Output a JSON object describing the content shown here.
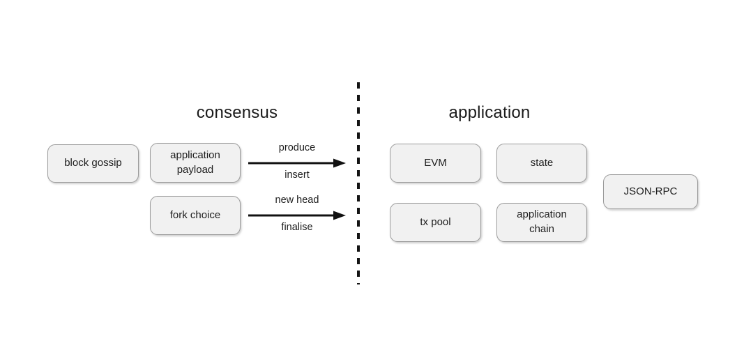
{
  "diagram": {
    "title_consensus": "consensus",
    "title_application": "application",
    "consensus_nodes": [
      {
        "id": "block-gossip",
        "label": "block gossip"
      },
      {
        "id": "application-payload",
        "label_line1": "application",
        "label_line2": "payload"
      },
      {
        "id": "fork-choice",
        "label": "fork choice"
      }
    ],
    "application_nodes": [
      {
        "id": "evm",
        "label": "EVM"
      },
      {
        "id": "state",
        "label": "state"
      },
      {
        "id": "tx-pool",
        "label": "tx pool"
      },
      {
        "id": "application-chain",
        "label_line1": "application",
        "label_line2": "chain"
      },
      {
        "id": "json-rpc",
        "label": "JSON-RPC"
      }
    ],
    "edges": [
      {
        "id": "produce-insert",
        "above_label": "produce",
        "below_label": "insert",
        "direction": "right",
        "from": "application-payload",
        "to": "application"
      },
      {
        "id": "newhead-finalise",
        "above_label": "new head",
        "below_label": "finalise",
        "direction": "right",
        "from": "fork-choice",
        "to": "application"
      }
    ],
    "divider": {
      "style": "dashed",
      "orientation": "vertical"
    },
    "colors": {
      "background": "#ffffff",
      "node_fill": "#f1f1f1",
      "node_border": "#9b9b9b",
      "text": "#1d1d1d",
      "arrow": "#111111",
      "divider": "#141414"
    }
  }
}
